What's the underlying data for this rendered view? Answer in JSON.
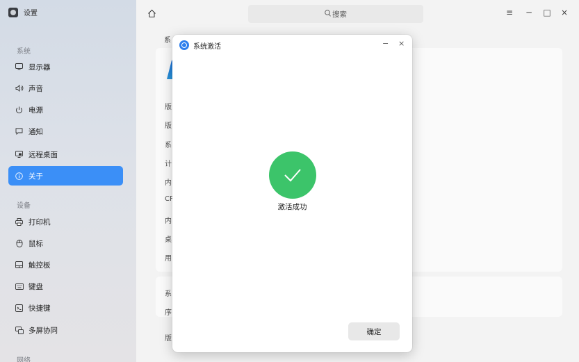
{
  "app": {
    "title": "设置",
    "icon": "settings-app-icon"
  },
  "sidebar": {
    "groups": [
      {
        "title": "系统"
      },
      {
        "title": "设备"
      },
      {
        "title": "网络"
      }
    ],
    "items": [
      {
        "label": "显示器",
        "icon": "monitor-icon"
      },
      {
        "label": "声音",
        "icon": "speaker-icon"
      },
      {
        "label": "电源",
        "icon": "power-icon"
      },
      {
        "label": "通知",
        "icon": "notification-icon"
      },
      {
        "label": "远程桌面",
        "icon": "remote-desktop-icon"
      },
      {
        "label": "关于",
        "icon": "info-icon",
        "active": true
      },
      {
        "label": "打印机",
        "icon": "printer-icon"
      },
      {
        "label": "鼠标",
        "icon": "mouse-icon"
      },
      {
        "label": "触控板",
        "icon": "touchpad-icon"
      },
      {
        "label": "键盘",
        "icon": "keyboard-icon"
      },
      {
        "label": "快捷键",
        "icon": "shortcut-icon"
      },
      {
        "label": "多屏协同",
        "icon": "multiscreen-icon"
      }
    ]
  },
  "header": {
    "search_label": "搜索",
    "window_controls": [
      "≡",
      "−",
      "□",
      "×"
    ]
  },
  "main": {
    "section_label": "系",
    "rows": [
      "版",
      "版",
      "系",
      "计",
      "内",
      "CP",
      "内",
      "桌",
      "用"
    ],
    "lower_rows": [
      "系",
      "序"
    ],
    "bottom_row": "版"
  },
  "dialog": {
    "title": "系统激活",
    "minimize": "−",
    "close": "×",
    "message": "激活成功",
    "ok_label": "确定"
  },
  "colors": {
    "accent": "#3b8ff7",
    "success": "#3cc46a",
    "sidebar_top": "#d3dbe6"
  }
}
